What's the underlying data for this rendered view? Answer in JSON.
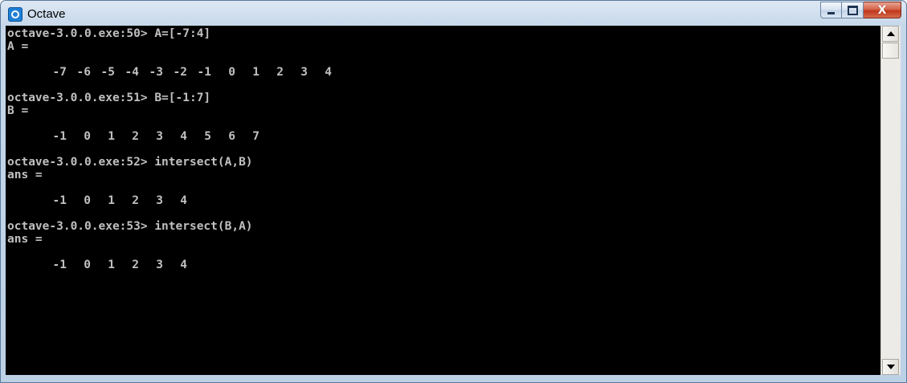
{
  "window": {
    "title": "Octave",
    "close_glyph": "X"
  },
  "icons": {
    "app": "octave-app-icon",
    "minimize": "minimize-icon",
    "maximize": "maximize-icon",
    "close": "close-icon",
    "scroll_up": "arrow-up-icon",
    "scroll_down": "arrow-down-icon"
  },
  "colors": {
    "console_bg": "#000000",
    "console_text": "#c0c0c0",
    "close_button": "#c0371d"
  },
  "console": {
    "blocks": [
      {
        "prompt": "octave-3.0.0.exe:50> A=[-7:4]",
        "result_label": "A =",
        "values": [
          "-7",
          "-6",
          "-5",
          "-4",
          "-3",
          "-2",
          "-1",
          "0",
          "1",
          "2",
          "3",
          "4"
        ]
      },
      {
        "prompt": "octave-3.0.0.exe:51> B=[-1:7]",
        "result_label": "B =",
        "values": [
          "-1",
          "0",
          "1",
          "2",
          "3",
          "4",
          "5",
          "6",
          "7"
        ]
      },
      {
        "prompt": "octave-3.0.0.exe:52> intersect(A,B)",
        "result_label": "ans =",
        "values": [
          "-1",
          "0",
          "1",
          "2",
          "3",
          "4"
        ]
      },
      {
        "prompt": "octave-3.0.0.exe:53> intersect(B,A)",
        "result_label": "ans =",
        "values": [
          "-1",
          "0",
          "1",
          "2",
          "3",
          "4"
        ]
      }
    ]
  }
}
